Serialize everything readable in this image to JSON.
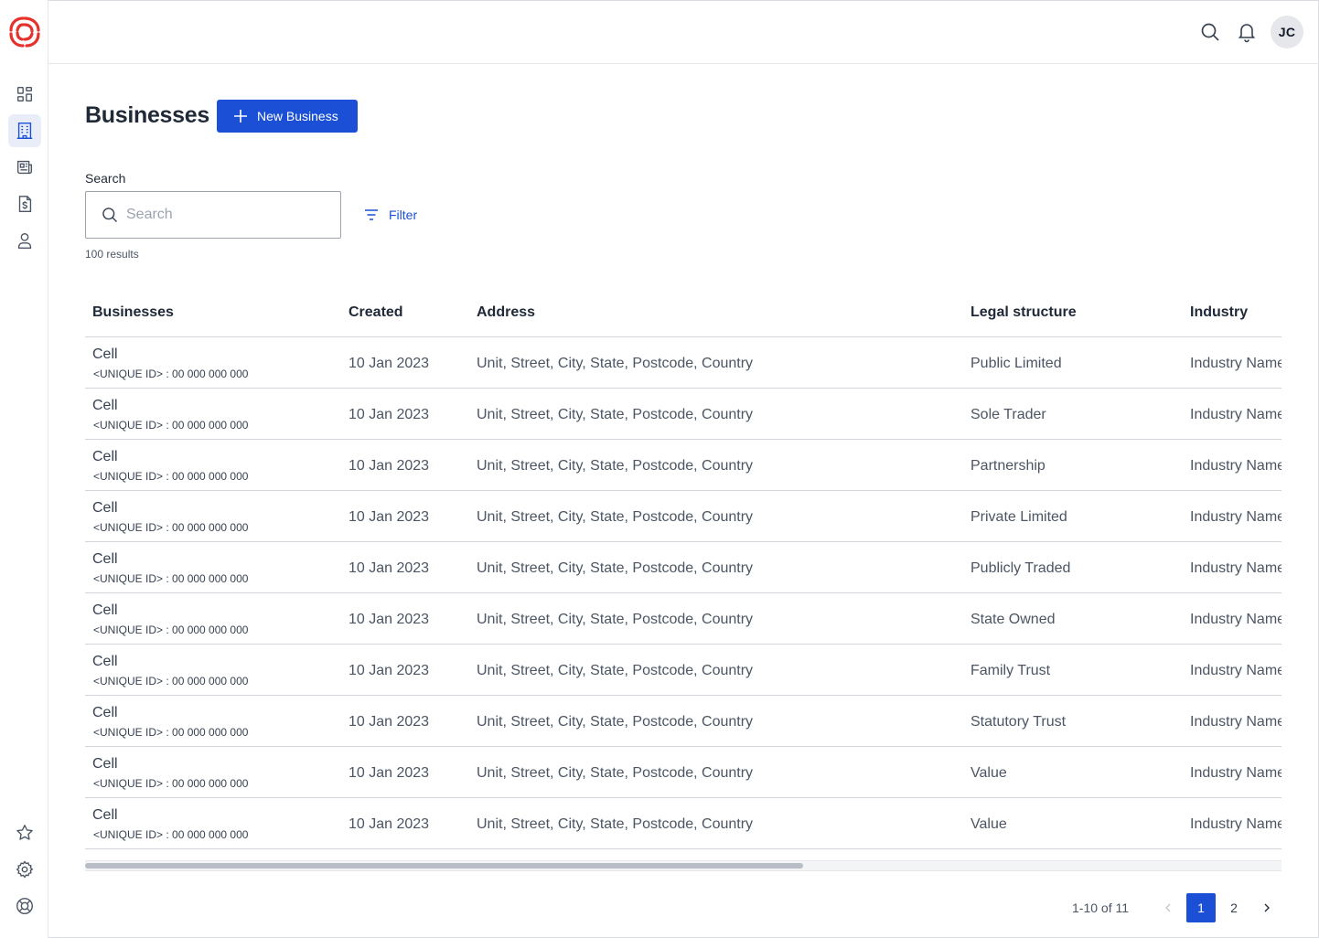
{
  "brand": {
    "color": "#e5322d",
    "accent": "#1a4fd6"
  },
  "sidebar": {
    "items": [
      {
        "name": "dashboard",
        "icon": "grid-icon",
        "active": false
      },
      {
        "name": "businesses",
        "icon": "building-icon",
        "active": true
      },
      {
        "name": "news",
        "icon": "newspaper-icon",
        "active": false
      },
      {
        "name": "invoices",
        "icon": "dollar-document-icon",
        "active": false
      },
      {
        "name": "people",
        "icon": "user-icon",
        "active": false
      }
    ],
    "bottom_items": [
      {
        "name": "favorites",
        "icon": "star-icon"
      },
      {
        "name": "settings",
        "icon": "gear-icon"
      },
      {
        "name": "help",
        "icon": "lifebuoy-icon"
      }
    ]
  },
  "topbar": {
    "avatar_initials": "JC"
  },
  "page": {
    "title": "Businesses",
    "new_button_label": "New Business",
    "search_label": "Search",
    "search_placeholder": "Search",
    "search_value": "",
    "filter_label": "Filter",
    "results_text": "100 results"
  },
  "table": {
    "columns": [
      "Businesses",
      "Created",
      "Address",
      "Legal structure",
      "Industry"
    ],
    "rows": [
      {
        "name": "Cell",
        "uid": "<UNIQUE ID> : 00 000 000 000",
        "created": "10 Jan 2023",
        "address": "Unit, Street, City, State, Postcode, Country",
        "legal": "Public Limited",
        "industry": "Industry Name"
      },
      {
        "name": "Cell",
        "uid": "<UNIQUE ID> : 00 000 000 000",
        "created": "10 Jan 2023",
        "address": "Unit, Street, City, State, Postcode, Country",
        "legal": "Sole Trader",
        "industry": "Industry Name"
      },
      {
        "name": "Cell",
        "uid": "<UNIQUE ID> : 00 000 000 000",
        "created": "10 Jan 2023",
        "address": "Unit, Street, City, State, Postcode, Country",
        "legal": "Partnership",
        "industry": "Industry Name"
      },
      {
        "name": "Cell",
        "uid": "<UNIQUE ID> : 00 000 000 000",
        "created": "10 Jan 2023",
        "address": "Unit, Street, City, State, Postcode, Country",
        "legal": "Private Limited",
        "industry": "Industry Name"
      },
      {
        "name": "Cell",
        "uid": "<UNIQUE ID> : 00 000 000 000",
        "created": "10 Jan 2023",
        "address": "Unit, Street, City, State, Postcode, Country",
        "legal": "Publicly Traded",
        "industry": "Industry Name"
      },
      {
        "name": "Cell",
        "uid": "<UNIQUE ID> : 00 000 000 000",
        "created": "10 Jan 2023",
        "address": "Unit, Street, City, State, Postcode, Country",
        "legal": "State Owned",
        "industry": "Industry Name"
      },
      {
        "name": "Cell",
        "uid": "<UNIQUE ID> : 00 000 000 000",
        "created": "10 Jan 2023",
        "address": "Unit, Street, City, State, Postcode, Country",
        "legal": "Family Trust",
        "industry": "Industry Name"
      },
      {
        "name": "Cell",
        "uid": "<UNIQUE ID> : 00 000 000 000",
        "created": "10 Jan 2023",
        "address": "Unit, Street, City, State, Postcode, Country",
        "legal": "Statutory Trust",
        "industry": "Industry Name"
      },
      {
        "name": "Cell",
        "uid": "<UNIQUE ID> : 00 000 000 000",
        "created": "10 Jan 2023",
        "address": "Unit, Street, City, State, Postcode, Country",
        "legal": "Value",
        "industry": "Industry Name"
      },
      {
        "name": "Cell",
        "uid": "<UNIQUE ID> : 00 000 000 000",
        "created": "10 Jan 2023",
        "address": "Unit, Street, City, State, Postcode, Country",
        "legal": "Value",
        "industry": "Industry Name"
      }
    ]
  },
  "pagination": {
    "info": "1-10 of 11",
    "pages": [
      "1",
      "2"
    ],
    "current": "1"
  }
}
